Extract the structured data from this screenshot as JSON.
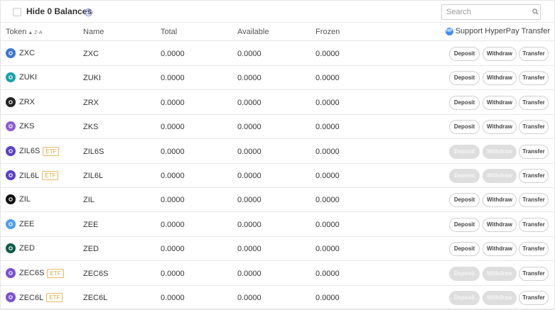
{
  "toolbar": {
    "hide_zero_label": "Hide 0 Balances",
    "help_glyph": "?",
    "search_placeholder": "Search",
    "search_icon": "search-icon"
  },
  "table": {
    "headers": {
      "token": "Token",
      "sort_indicator": "▲ Z-A",
      "name": "Name",
      "total": "Total",
      "available": "Available",
      "frozen": "Frozen",
      "hyperpay_logo": "HP",
      "support": "Support HyperPay Transfer"
    },
    "buttons": {
      "deposit": "Deposit",
      "withdraw": "Withdraw",
      "transfer": "Transfer"
    },
    "rows": [
      {
        "token": "ZXC",
        "etf": "",
        "name": "ZXC",
        "total": "0.0000",
        "available": "0.0000",
        "frozen": "0.0000",
        "icon": "zxc-icon",
        "icon_color": "#3a78d6",
        "enabled": true
      },
      {
        "token": "ZUKI",
        "etf": "",
        "name": "ZUKI",
        "total": "0.0000",
        "available": "0.0000",
        "frozen": "0.0000",
        "icon": "zuki-icon",
        "icon_color": "#1aa1a8",
        "enabled": true
      },
      {
        "token": "ZRX",
        "etf": "",
        "name": "ZRX",
        "total": "0.0000",
        "available": "0.0000",
        "frozen": "0.0000",
        "icon": "zrx-icon",
        "icon_color": "#222222",
        "enabled": true
      },
      {
        "token": "ZKS",
        "etf": "",
        "name": "ZKS",
        "total": "0.0000",
        "available": "0.0000",
        "frozen": "0.0000",
        "icon": "zks-icon",
        "icon_color": "#8b5cd6",
        "enabled": true
      },
      {
        "token": "ZIL6S",
        "etf": "ETF",
        "name": "ZIL6S",
        "total": "0.0000",
        "available": "0.0000",
        "frozen": "0.0000",
        "icon": "zil6s-icon",
        "icon_color": "#5b3fc9",
        "enabled": false
      },
      {
        "token": "ZIL6L",
        "etf": "ETF",
        "name": "ZIL6L",
        "total": "0.0000",
        "available": "0.0000",
        "frozen": "0.0000",
        "icon": "zil6l-icon",
        "icon_color": "#5b3fc9",
        "enabled": false
      },
      {
        "token": "ZIL",
        "etf": "",
        "name": "ZIL",
        "total": "0.0000",
        "available": "0.0000",
        "frozen": "0.0000",
        "icon": "zil-icon",
        "icon_color": "#111111",
        "enabled": true
      },
      {
        "token": "ZEE",
        "etf": "",
        "name": "ZEE",
        "total": "0.0000",
        "available": "0.0000",
        "frozen": "0.0000",
        "icon": "zee-icon",
        "icon_color": "#4a9ff0",
        "enabled": true
      },
      {
        "token": "ZED",
        "etf": "",
        "name": "ZED",
        "total": "0.0000",
        "available": "0.0000",
        "frozen": "0.0000",
        "icon": "zed-icon",
        "icon_color": "#0f5c4a",
        "enabled": true
      },
      {
        "token": "ZEC6S",
        "etf": "ETF",
        "name": "ZEC6S",
        "total": "0.0000",
        "available": "0.0000",
        "frozen": "0.0000",
        "icon": "zec6s-icon",
        "icon_color": "#7a4fd6",
        "enabled": false
      },
      {
        "token": "ZEC6L",
        "etf": "ETF",
        "name": "ZEC6L",
        "total": "0.0000",
        "available": "0.0000",
        "frozen": "0.0000",
        "icon": "zec6l-icon",
        "icon_color": "#7a4fd6",
        "enabled": false
      }
    ]
  },
  "colors": {
    "border": "#e8e8e8",
    "etf_badge": "#d9a53a",
    "disabled_button": "#dedede",
    "hyperpay_blue": "#3f8ef7"
  }
}
